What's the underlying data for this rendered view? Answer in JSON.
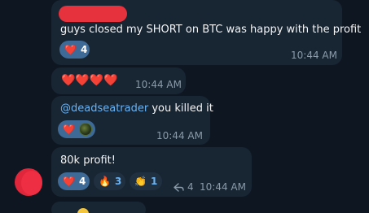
{
  "messages": [
    {
      "text": "guys closed my SHORT on BTC was happy with the profit",
      "reactions": [
        {
          "emoji": "❤️",
          "count": "4"
        }
      ],
      "time": "10:44 AM"
    },
    {
      "text": "❤️❤️❤️❤️",
      "time": "10:44 AM"
    },
    {
      "mention": "@deadseatrader",
      "text": " you killed it",
      "reactions": [
        {
          "emoji": "❤️"
        }
      ],
      "time": "10:44 AM"
    },
    {
      "text": "80k profit!",
      "reactions": [
        {
          "emoji": "❤️",
          "count": "4"
        },
        {
          "emoji": "🔥",
          "count": "3"
        },
        {
          "emoji": "👏",
          "count": "1"
        }
      ],
      "forwards": "4",
      "time": "10:44 AM"
    }
  ],
  "colors": {
    "background": "#0e1621",
    "bubble": "#182533",
    "accent": "#6ab3f3",
    "reaction_active": "#3d6a97",
    "redaction": "#e6323c"
  },
  "icons": {
    "forward": "share-arrow-icon"
  }
}
